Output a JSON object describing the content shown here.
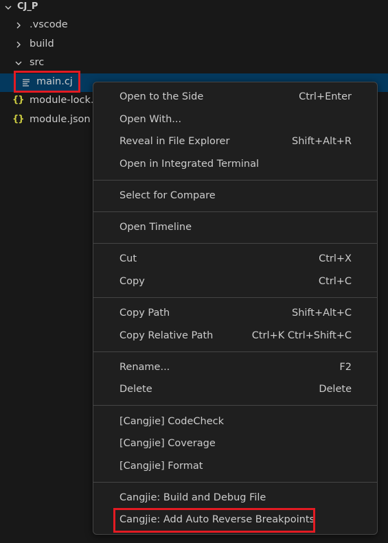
{
  "explorer": {
    "root_label": "CJ_P",
    "items": [
      {
        "label": ".vscode",
        "kind": "folder",
        "expanded": false
      },
      {
        "label": "build",
        "kind": "folder",
        "expanded": false
      },
      {
        "label": "src",
        "kind": "folder",
        "expanded": true
      },
      {
        "label": "main.cj",
        "kind": "file",
        "selected": true
      },
      {
        "label": "module-lock.json",
        "kind": "json"
      },
      {
        "label": "module.json",
        "kind": "json"
      }
    ]
  },
  "context_menu": {
    "groups": [
      [
        {
          "label": "Open to the Side",
          "shortcut": "Ctrl+Enter"
        },
        {
          "label": "Open With...",
          "shortcut": ""
        },
        {
          "label": "Reveal in File Explorer",
          "shortcut": "Shift+Alt+R"
        },
        {
          "label": "Open in Integrated Terminal",
          "shortcut": ""
        }
      ],
      [
        {
          "label": "Select for Compare",
          "shortcut": ""
        }
      ],
      [
        {
          "label": "Open Timeline",
          "shortcut": ""
        }
      ],
      [
        {
          "label": "Cut",
          "shortcut": "Ctrl+X"
        },
        {
          "label": "Copy",
          "shortcut": "Ctrl+C"
        }
      ],
      [
        {
          "label": "Copy Path",
          "shortcut": "Shift+Alt+C"
        },
        {
          "label": "Copy Relative Path",
          "shortcut": "Ctrl+K Ctrl+Shift+C"
        }
      ],
      [
        {
          "label": "Rename...",
          "shortcut": "F2"
        },
        {
          "label": "Delete",
          "shortcut": "Delete"
        }
      ],
      [
        {
          "label": "[Cangjie] CodeCheck",
          "shortcut": ""
        },
        {
          "label": "[Cangjie] Coverage",
          "shortcut": ""
        },
        {
          "label": "[Cangjie] Format",
          "shortcut": ""
        }
      ],
      [
        {
          "label": "Cangjie: Build and Debug File",
          "shortcut": ""
        },
        {
          "label": "Cangjie: Add Auto Reverse Breakpoints",
          "shortcut": ""
        }
      ]
    ]
  },
  "colors": {
    "background": "#181818",
    "menu_background": "#1f1f1f",
    "selection": "#04395e",
    "highlight_annotation": "#e31b23",
    "json_icon": "#cbcb41"
  },
  "icons": {
    "root_chevron": "chevron-down-icon",
    "collapsed_chevron": "chevron-right-icon",
    "file": "file-lines-icon",
    "json": "json-braces-icon"
  }
}
